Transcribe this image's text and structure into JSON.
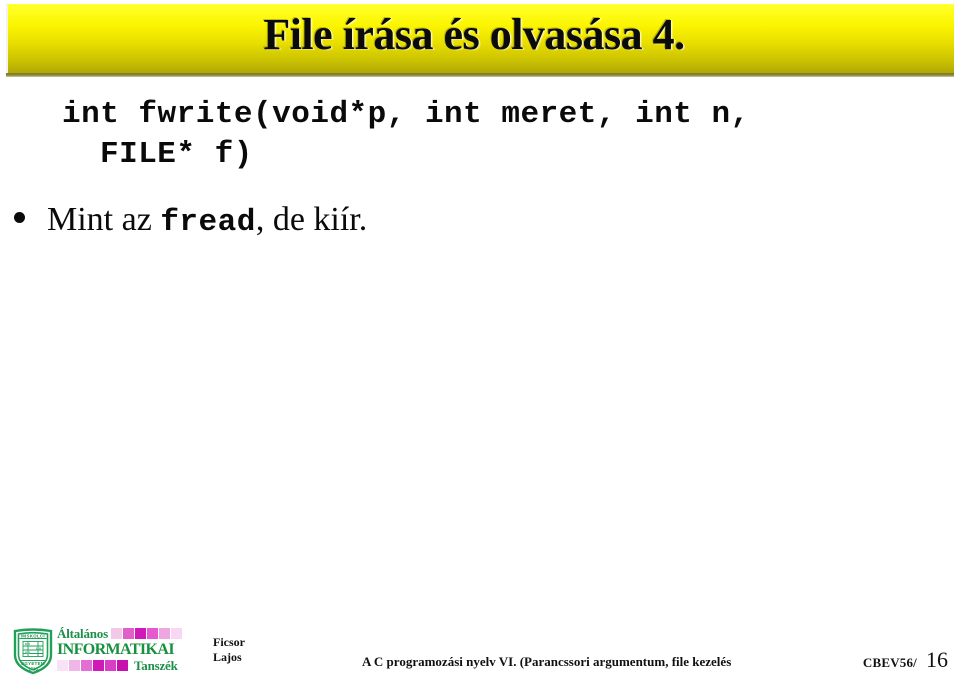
{
  "slide": {
    "title": "File írása és olvasása 4.",
    "banner_color_top": "#ffff33",
    "banner_color_bottom": "#a8a008",
    "code_lines": [
      "int fwrite(void*p, int meret, int n,",
      "FILE* f)"
    ],
    "bullets": [
      {
        "prefix": "Mint az ",
        "mono": "fread",
        "suffix": ", de kiír."
      }
    ]
  },
  "footer": {
    "seal": {
      "top_text": "MISKOLCI",
      "bottom_text": "EGYETEM",
      "year": "1735",
      "color": "#21a05a"
    },
    "department_logo": {
      "line1": "Általános",
      "line2": "INFORMATIKAI",
      "line3": "Tanszék",
      "text_color": "#1d8f4a",
      "block_colors_top": [
        "#f3c9ea",
        "#e060c8",
        "#cf19b8",
        "#e55bcf",
        "#efa7e2",
        "#f7d7f1"
      ],
      "block_colors_bottom": [
        "#f9e2f5",
        "#f0b6e8",
        "#e36fd4",
        "#cf19b8",
        "#d93fc6",
        "#c711ae"
      ]
    },
    "author_line1": "Ficsor",
    "author_line2": "Lajos",
    "subject": "A C programozási nyelv VI. (Parancssori argumentum, file kezelés",
    "page_code": "CBEV56/",
    "page_number": "16"
  }
}
